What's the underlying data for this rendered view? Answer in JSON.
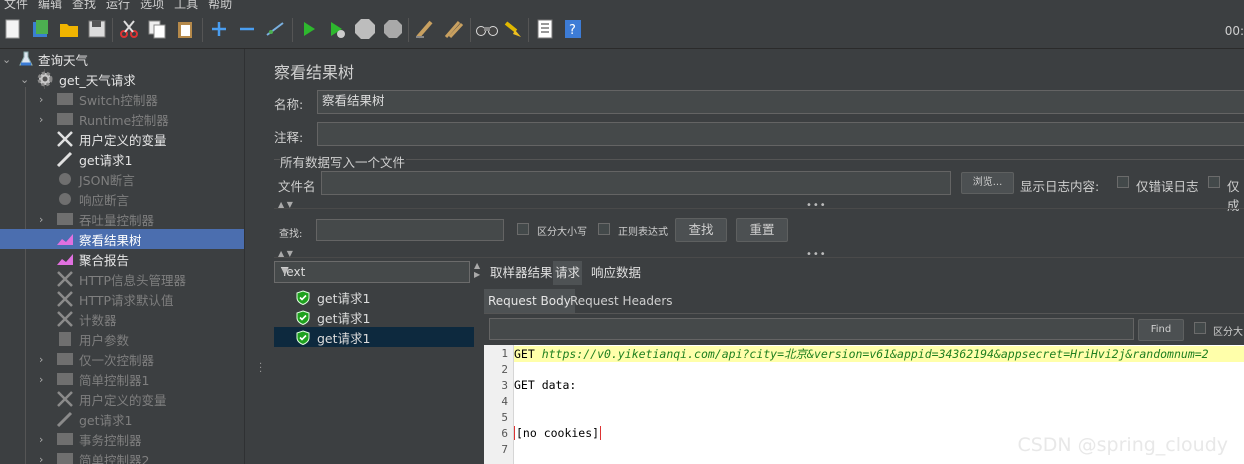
{
  "menu": [
    "文件",
    "编辑",
    "查找",
    "运行",
    "选项",
    "工具",
    "帮助"
  ],
  "toolbar": {
    "timer": "00:",
    "icons": [
      "new-icon",
      "templates-icon",
      "open-icon",
      "save-icon",
      "cut-icon",
      "copy-icon",
      "paste-icon",
      "add-icon",
      "remove-icon",
      "toggle-icon",
      "start-icon",
      "start-no-pause-icon",
      "stop-icon",
      "shutdown-icon",
      "clear-icon",
      "clear-all-icon",
      "search-binoculars-icon",
      "broom-icon",
      "function-helper-icon",
      "help-icon"
    ]
  },
  "tree": {
    "items": [
      {
        "label": "查询天气",
        "enabled": true
      },
      {
        "label": "get_天气请求",
        "enabled": true
      },
      {
        "label": "Switch控制器",
        "enabled": false
      },
      {
        "label": "Runtime控制器",
        "enabled": false
      },
      {
        "label": "用户定义的变量",
        "enabled": true
      },
      {
        "label": "get请求1",
        "enabled": true
      },
      {
        "label": "JSON断言",
        "enabled": false
      },
      {
        "label": "响应断言",
        "enabled": false
      },
      {
        "label": "吞吐量控制器",
        "enabled": false
      },
      {
        "label": "察看结果树",
        "enabled": true,
        "selected": true
      },
      {
        "label": "聚合报告",
        "enabled": true
      },
      {
        "label": "HTTP信息头管理器",
        "enabled": false
      },
      {
        "label": "HTTP请求默认值",
        "enabled": false
      },
      {
        "label": "计数器",
        "enabled": false
      },
      {
        "label": "用户参数",
        "enabled": false
      },
      {
        "label": "仅一次控制器",
        "enabled": false
      },
      {
        "label": "简单控制器1",
        "enabled": false
      },
      {
        "label": "用户定义的变量",
        "enabled": false
      },
      {
        "label": "get请求1",
        "enabled": false
      },
      {
        "label": "事务控制器",
        "enabled": false
      },
      {
        "label": "简单控制器2",
        "enabled": false
      }
    ]
  },
  "panel": {
    "title": "察看结果树",
    "name_label": "名称:",
    "name_value": "察看结果树",
    "comment_label": "注释:",
    "comment_value": "",
    "file_section": "所有数据写入一个文件",
    "file_label": "文件名",
    "file_value": "",
    "browse": "浏览...",
    "log_label": "显示日志内容:",
    "errors_only": "仅错误日志",
    "success_only": "仅成",
    "search_label": "查找:",
    "case_sensitive": "区分大小写",
    "regex": "正则表达式",
    "find_btn": "查找",
    "reset_btn": "重置"
  },
  "results": {
    "renderer": "Text",
    "samples": [
      "get请求1",
      "get请求1",
      "get请求1"
    ]
  },
  "tabs": [
    "取样器结果",
    "请求",
    "响应数据"
  ],
  "subtabs": [
    "Request Body",
    "Request Headers"
  ],
  "find": {
    "button": "Find",
    "case_label": "区分大"
  },
  "editor": {
    "line_numbers": [
      "1",
      "2",
      "3",
      "4",
      "5",
      "6",
      "7"
    ],
    "line1_method": "GET ",
    "line1_url": "https://v0.yiketianqi.com/api?city=北京&version=v61&appid=34362194&appsecret=HriHvi2j&randomnum=2",
    "line3": "GET data:",
    "line6": "[no cookies]"
  },
  "watermark": "CSDN @spring_cloudy"
}
